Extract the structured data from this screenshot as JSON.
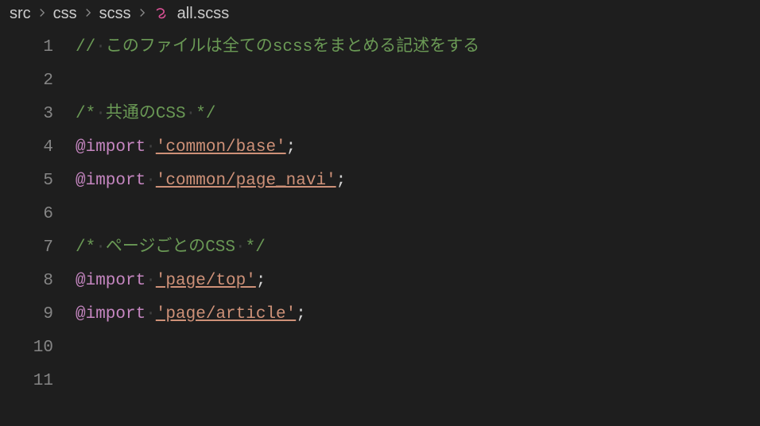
{
  "breadcrumb": {
    "items": [
      "src",
      "css",
      "scss",
      "all.scss"
    ]
  },
  "lines": {
    "numbers": [
      "1",
      "2",
      "3",
      "4",
      "5",
      "6",
      "7",
      "8",
      "9",
      "10",
      "11"
    ]
  },
  "code": {
    "line1_comment": "// このファイルは全てのscssをまとめる記述をする",
    "line3_open": "/* ",
    "line3_text": "共通のCSS",
    "line3_close": " */",
    "line4_kw": "@import",
    "line4_str": "'common/base'",
    "line4_semi": ";",
    "line5_kw": "@import",
    "line5_str": "'common/page_navi'",
    "line5_semi": ";",
    "line7_open": "/* ",
    "line7_text": "ページごとのCSS",
    "line7_close": " */",
    "line8_kw": "@import",
    "line8_str": "'page/top'",
    "line8_semi": ";",
    "line9_kw": "@import",
    "line9_str": "'page/article'",
    "line9_semi": ";"
  }
}
